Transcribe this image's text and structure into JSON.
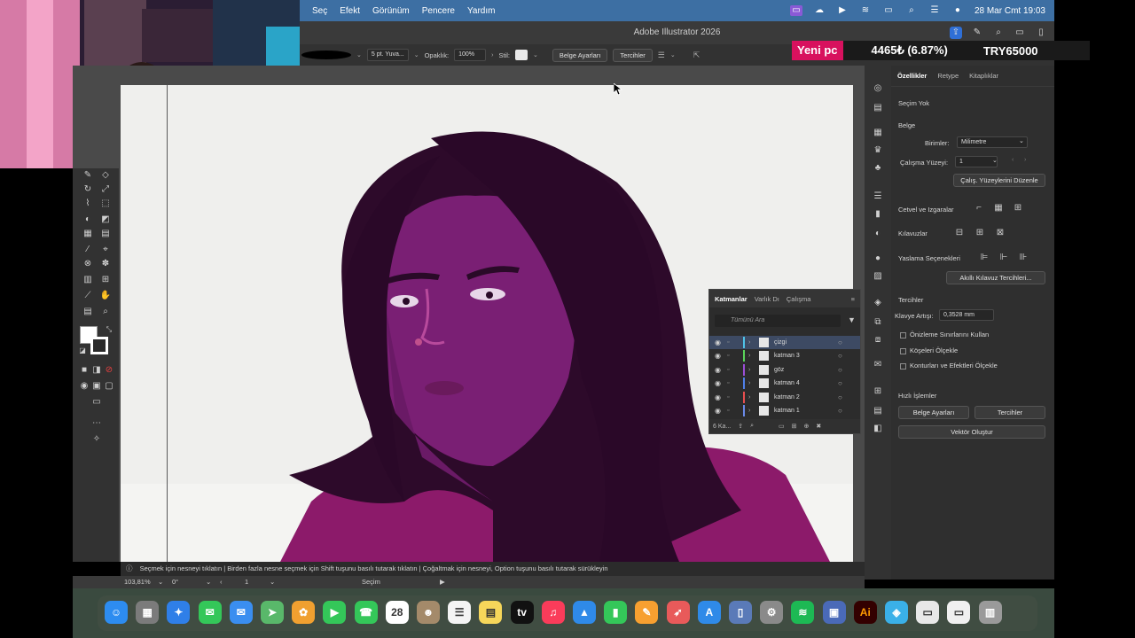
{
  "menubar": {
    "items": [
      "Seç",
      "Efekt",
      "Görünüm",
      "Pencere",
      "Yardım"
    ],
    "clock": "28 Mar Cmt  19:03"
  },
  "window": {
    "title": "Adobe Illustrator 2026"
  },
  "controlbar": {
    "brush": "5 pt. Yuva...",
    "opacity_label": "Opaklık:",
    "opacity_value": "100%",
    "style_label": "Stil:",
    "doc_setup": "Belge Ayarları",
    "prefs": "Tercihler"
  },
  "overlay": {
    "badge": "Yeni pc",
    "value": "4465₺ (6.87%)",
    "goal": "TRY65000"
  },
  "properties": {
    "tabs": [
      "Özellikler",
      "Retype",
      "Kitaplıklar"
    ],
    "no_selection": "Seçim Yok",
    "document": "Belge",
    "units_label": "Birimler:",
    "units_value": "Milimetre",
    "artboard_label": "Çalışma Yüzeyi:",
    "artboard_value": "1",
    "edit_artboards": "Çalış. Yüzeylerini Düzenle",
    "rulers_grid": "Cetvel ve Izgaralar",
    "guides": "Kılavuzlar",
    "snap": "Yaslama Seçenekleri",
    "smart_guides": "Akıllı Kılavuz Tercihleri...",
    "prefs_title": "Tercihler",
    "key_increment_label": "Klavye Artışı:",
    "key_increment_value": "0,3528 mm",
    "checks": [
      "Önizleme Sınırlarını Kullan",
      "Köşeleri Ölçekle",
      "Konturları ve Efektleri Ölçekle"
    ],
    "quick_actions": "Hızlı İşlemler",
    "qa_doc_setup": "Belge Ayarları",
    "qa_prefs": "Tercihler",
    "vector_create": "Vektör Oluştur"
  },
  "layers": {
    "tabs": [
      "Katmanlar",
      "Varlık Dı",
      "Çalışma"
    ],
    "search_placeholder": "Tümünü Ara",
    "rows": [
      {
        "name": "çizgi",
        "color": "#4fc3e8"
      },
      {
        "name": "katman 3",
        "color": "#5ad35a"
      },
      {
        "name": "göz",
        "color": "#9c4fd6"
      },
      {
        "name": "katman 4",
        "color": "#4f7fe8"
      },
      {
        "name": "katman 2",
        "color": "#e84f4f"
      },
      {
        "name": "katman 1",
        "color": "#6a8ae8"
      }
    ],
    "footer_count": "6 Ka..."
  },
  "status": {
    "hint": "Seçmek için nesneyi tıklatın  |  Birden fazla nesne seçmek için Shift tuşunu basılı tutarak tıklatın  |  Çoğaltmak için nesneyi, Option tuşunu basılı tutarak sürükleyin",
    "zoom": "103,81%",
    "rotation": "0°",
    "artboard": "1",
    "tool": "Seçim"
  },
  "dock": {
    "icons": [
      {
        "name": "finder-icon",
        "color": "#2d8cf0",
        "glyph": "☺"
      },
      {
        "name": "launchpad-icon",
        "color": "#7b7b7b",
        "glyph": "▦"
      },
      {
        "name": "safari-icon",
        "color": "#2f7fe8",
        "glyph": "✦"
      },
      {
        "name": "messages-icon",
        "color": "#34c759",
        "glyph": "✉"
      },
      {
        "name": "mail-icon",
        "color": "#3a8ef0",
        "glyph": "✉"
      },
      {
        "name": "maps-icon",
        "color": "#59b86a",
        "glyph": "➤"
      },
      {
        "name": "photos-icon",
        "color": "#f0a030",
        "glyph": "✿"
      },
      {
        "name": "facetime-icon",
        "color": "#34c759",
        "glyph": "▶"
      },
      {
        "name": "phone-icon",
        "color": "#34c759",
        "glyph": "☎"
      },
      {
        "name": "calendar-icon",
        "color": "#ffffff",
        "glyph": "28"
      },
      {
        "name": "contacts-icon",
        "color": "#a48a6a",
        "glyph": "☻"
      },
      {
        "name": "reminders-icon",
        "color": "#f4f4f4",
        "glyph": "☰"
      },
      {
        "name": "notes-icon",
        "color": "#f6d65a",
        "glyph": "▤"
      },
      {
        "name": "tv-icon",
        "color": "#111111",
        "glyph": "tv"
      },
      {
        "name": "music-icon",
        "color": "#fa3c5a",
        "glyph": "♫"
      },
      {
        "name": "keynote-icon",
        "color": "#2f8ae8",
        "glyph": "▲"
      },
      {
        "name": "numbers-icon",
        "color": "#34c759",
        "glyph": "▮"
      },
      {
        "name": "pages-icon",
        "color": "#f7a030",
        "glyph": "✎"
      },
      {
        "name": "rocket-icon",
        "color": "#e85a5a",
        "glyph": "➶"
      },
      {
        "name": "appstore-icon",
        "color": "#2f8ae8",
        "glyph": "A"
      },
      {
        "name": "preview-icon",
        "color": "#5a7ab8",
        "glyph": "▯"
      },
      {
        "name": "settings-icon",
        "color": "#8a8a8a",
        "glyph": "⚙"
      },
      {
        "name": "spotify-icon",
        "color": "#1db954",
        "glyph": "≋"
      },
      {
        "name": "finder2-icon",
        "color": "#4a6ab8",
        "glyph": "▣"
      },
      {
        "name": "illustrator-icon",
        "color": "#330000",
        "glyph": "Ai"
      },
      {
        "name": "vpn-icon",
        "color": "#3ab0e8",
        "glyph": "◈"
      },
      {
        "name": "document-icon",
        "color": "#e8e8e8",
        "glyph": "▭"
      },
      {
        "name": "downloads-icon",
        "color": "#f0f0f0",
        "glyph": "▭"
      },
      {
        "name": "trash-icon",
        "color": "#9a9a9a",
        "glyph": "▥"
      }
    ]
  }
}
